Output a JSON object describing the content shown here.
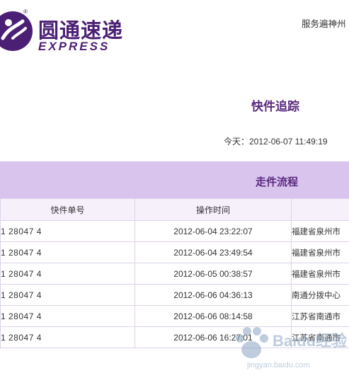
{
  "header": {
    "logo_cn": "圆通速递",
    "logo_en": "EXPRESS",
    "reg_mark": "®",
    "slogan": "服务遍神州 "
  },
  "page": {
    "title": "快件追踪",
    "today": "今天：2012-06-07 11:49:19"
  },
  "section": {
    "title": "走件流程"
  },
  "table": {
    "columns": [
      "快件单号",
      "操作时间",
      ""
    ],
    "rows": [
      {
        "number": "1 28047 4",
        "time": "2012-06-04 23:22:07",
        "place": "福建省泉州市"
      },
      {
        "number": "1 28047 4",
        "time": "2012-06-04 23:49:54",
        "place": "福建省泉州市"
      },
      {
        "number": "1 28047 4",
        "time": "2012-06-05 00:38:57",
        "place": "福建省泉州市"
      },
      {
        "number": "1 28047 4",
        "time": "2012-06-06 04:36:13",
        "place": "南通分拨中心"
      },
      {
        "number": "1 28047 4",
        "time": "2012-06-06 08:14:58",
        "place": "江苏省南通市"
      },
      {
        "number": "1 28047 4",
        "time": "2012-06-06 16:27:01",
        "place": "江苏省南通市"
      }
    ]
  },
  "watermark": {
    "text": "Baidu经验",
    "sub": "jingyan.baidu.com"
  },
  "colors": {
    "brand": "#4b1f74",
    "band": "#d9c4ee",
    "title": "#5a2a7e"
  }
}
